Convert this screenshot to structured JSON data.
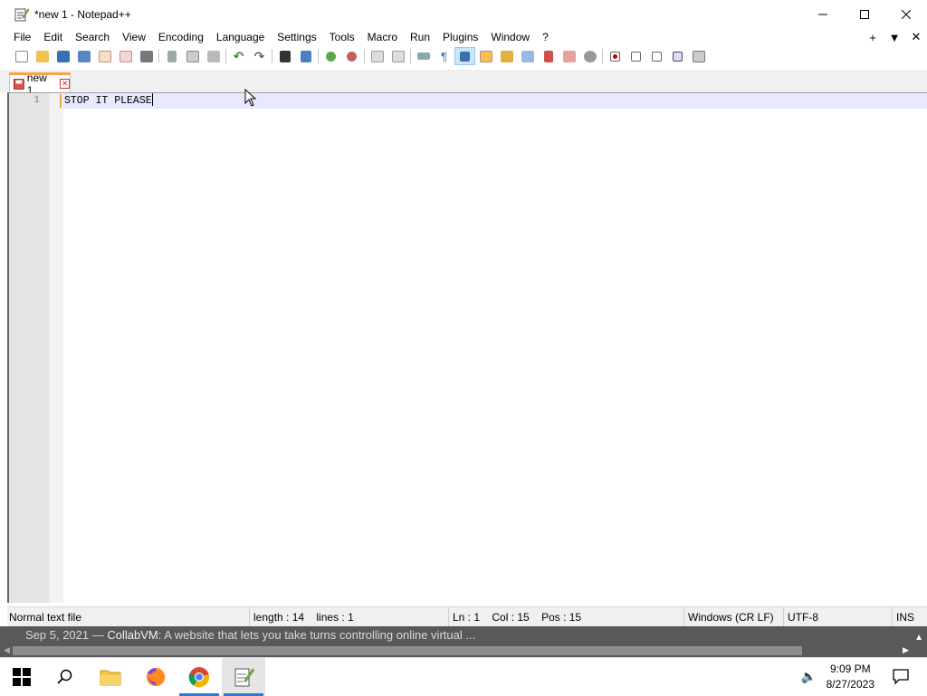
{
  "window": {
    "title": "*new 1 - Notepad++"
  },
  "menu": {
    "items": [
      "File",
      "Edit",
      "Search",
      "View",
      "Encoding",
      "Language",
      "Settings",
      "Tools",
      "Macro",
      "Run",
      "Plugins",
      "Window",
      "?"
    ],
    "right_controls": [
      "+",
      "▼",
      "✕"
    ]
  },
  "tab": {
    "label": "new 1"
  },
  "editor": {
    "line_number": "1",
    "text": "STOP IT PLEASE"
  },
  "status": {
    "file_type": "Normal text file",
    "length": "length : 14",
    "lines": "lines : 1",
    "ln": "Ln : 1",
    "col": "Col : 15",
    "pos": "Pos : 15",
    "eol": "Windows (CR LF)",
    "encoding": "UTF-8",
    "mode": "INS"
  },
  "banner": {
    "date": "Sep 5, 2021",
    "dash": " — ",
    "brand": "CollabVM",
    "text": ": A website that lets you take turns controlling online virtual ..."
  },
  "taskbar": {
    "time": "9:09 PM",
    "date": "8/27/2023"
  },
  "colors": {
    "tab_accent": "#f7a34b",
    "current_line": "#e8e8ff",
    "taskbar_active_underline": "#2e7bd7",
    "banner_bg": "#595959"
  },
  "icons": {
    "toolbar": [
      "new-file-icon",
      "open-file-icon",
      "save-icon",
      "save-all-icon",
      "close-icon",
      "close-all-icon",
      "print-icon",
      "cut-icon",
      "copy-icon",
      "paste-icon",
      "undo-icon",
      "redo-icon",
      "find-icon",
      "replace-icon",
      "zoom-in-icon",
      "zoom-out-icon",
      "sync-vertical-icon",
      "sync-horizontal-icon",
      "word-wrap-icon",
      "show-all-chars-icon",
      "indent-guide-icon",
      "user-language-icon",
      "doc-map-icon",
      "doc-list-icon",
      "function-list-icon",
      "folder-workspace-icon",
      "monitoring-icon",
      "record-macro-icon",
      "stop-macro-icon",
      "play-macro-icon",
      "run-macro-multiple-icon",
      "save-macro-icon"
    ]
  }
}
